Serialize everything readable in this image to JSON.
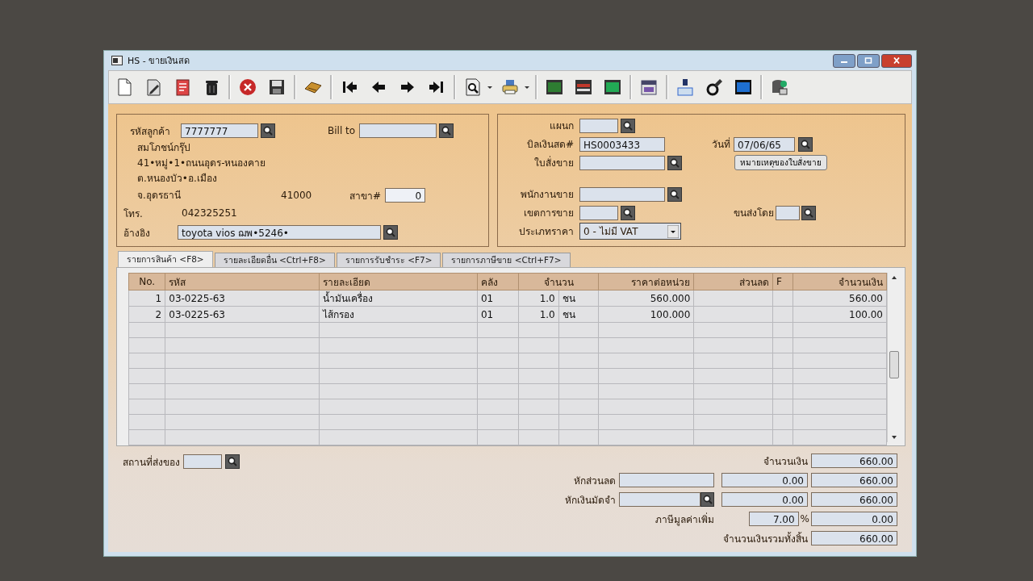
{
  "window": {
    "title": "HS - ขายเงินสด"
  },
  "customer": {
    "code": {
      "label": "รหัสลูกค้า",
      "value": "7777777"
    },
    "bill_to": {
      "label": "Bill to"
    },
    "name": "สมโภชน์กรุ๊ป",
    "address_lines": [
      "41•หมู่•1•ถนนอุดร-หนองคาย",
      "ต.หนองบัว•อ.เมือง"
    ],
    "province": "จ.อุดรธานี",
    "postcode": "41000",
    "branch": {
      "label": "สาขา#",
      "value": "0"
    },
    "phone": {
      "label": "โทร.",
      "value": "042325251"
    },
    "reference": {
      "label": "อ้างอิง",
      "value": "toyota vios ฌพ•5246•"
    }
  },
  "document": {
    "department": {
      "label": "แผนก"
    },
    "cash_bill": {
      "label": "บิลเงินสด#",
      "value": "HS0003433"
    },
    "sales_order": {
      "label": "ใบสั่งขาย"
    },
    "date": {
      "label": "วันที่",
      "value": "07/06/65"
    },
    "notes_button": "หมายเหตุของใบสั่งขาย",
    "salesperson": {
      "label": "พนักงานขาย"
    },
    "sales_area": {
      "label": "เขตการขาย"
    },
    "shipped_by": {
      "label": "ขนส่งโดย"
    },
    "price_type": {
      "label": "ประเภทราคา",
      "value": "0 - ไม่มี VAT"
    }
  },
  "tabs": [
    {
      "label": "รายการสินค้า <F8>",
      "selected": true
    },
    {
      "label": "รายละเอียดอื่น <Ctrl+F8>",
      "selected": false
    },
    {
      "label": "รายการรับชำระ <F7>",
      "selected": false
    },
    {
      "label": "รายการภาษีขาย <Ctrl+F7>",
      "selected": false
    }
  ],
  "table": {
    "columns": [
      "No.",
      "รหัส",
      "รายละเอียด",
      "คลัง",
      "จำนวน",
      "ราคาต่อหน่วย",
      "ส่วนลด",
      "F",
      "จำนวนเงิน"
    ],
    "rows": [
      {
        "no": "1",
        "code": "03-0225-63",
        "description": "น้ำมันเครื่อง",
        "warehouse": "01",
        "quantity": "1.0",
        "unit": "ชน",
        "unit_price": "560.000",
        "amount": "560.00"
      },
      {
        "no": "2",
        "code": "03-0225-63",
        "description": "ไส้กรอง",
        "warehouse": "01",
        "quantity": "1.0",
        "unit": "ชน",
        "unit_price": "100.000",
        "amount": "100.00"
      }
    ]
  },
  "delivery": {
    "label": "สถานที่ส่งของ"
  },
  "totals": {
    "amount": {
      "label": "จำนวนเงิน",
      "value": "660.00"
    },
    "discount": {
      "label": "หักส่วนลด",
      "deducted": "0.00",
      "balance": "660.00"
    },
    "deposit": {
      "label": "หักเงินมัดจำ",
      "deducted": "0.00",
      "balance": "660.00"
    },
    "vat": {
      "label": "ภาษีมูลค่าเพิ่ม",
      "rate": "7.00",
      "percent_sign": "%",
      "value": "0.00"
    },
    "grand_total": {
      "label": "จำนวนเงินรวมทั้งสิ้น",
      "value": "660.00"
    }
  }
}
